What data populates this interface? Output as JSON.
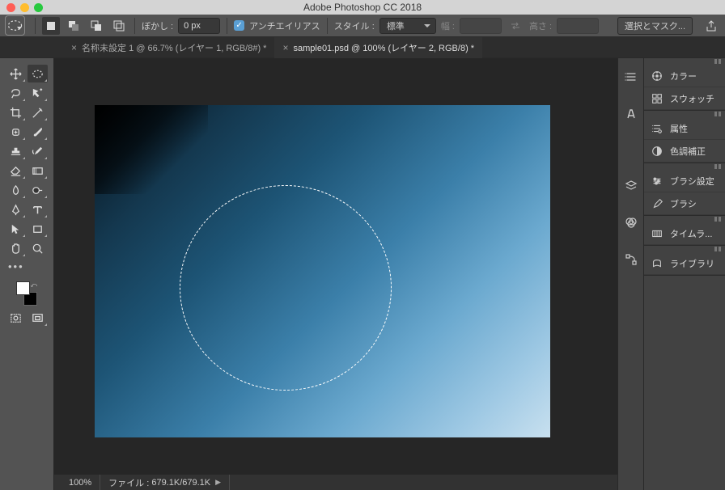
{
  "app_title": "Adobe Photoshop CC 2018",
  "traffic": {
    "close": "#ff5f56",
    "min": "#ffbd2e",
    "max": "#27c93f"
  },
  "options": {
    "feather_label": "ぼかし :",
    "feather_value": "0 px",
    "antialias_label": "アンチエイリアス",
    "style_label": "スタイル :",
    "style_value": "標準",
    "width_label": "幅 :",
    "height_label": "高さ :",
    "select_mask": "選択とマスク...",
    "width_value": "",
    "height_value": ""
  },
  "tabs": [
    {
      "label": "名称未設定 1 @ 66.7% (レイヤー 1, RGB/8#) *",
      "active": false
    },
    {
      "label": "sample01.psd @ 100% (レイヤー 2, RGB/8) *",
      "active": true
    }
  ],
  "status": {
    "zoom": "100%",
    "file_label": "ファイル :",
    "file_value": "679.1K/679.1K"
  },
  "panels": {
    "color": "カラー",
    "swatches": "スウォッチ",
    "properties": "属性",
    "adjustments": "色調補正",
    "brush_settings": "ブラシ設定",
    "brush": "ブラシ",
    "timeline": "タイムラ...",
    "library": "ライブラリ"
  }
}
